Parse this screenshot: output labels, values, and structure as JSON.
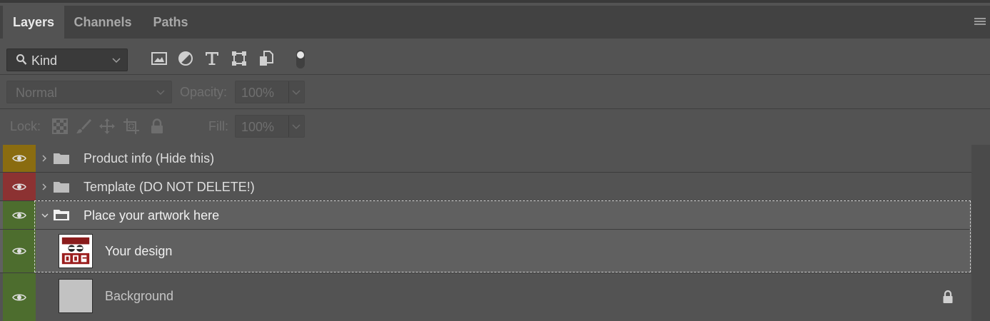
{
  "tabs": [
    {
      "label": "Layers",
      "active": true
    },
    {
      "label": "Channels",
      "active": false
    },
    {
      "label": "Paths",
      "active": false
    }
  ],
  "filter": {
    "kind_label": "Kind",
    "filter_icons": [
      "image-filter-icon",
      "adjustment-filter-icon",
      "type-filter-icon",
      "shape-filter-icon",
      "smart-object-filter-icon",
      "filter-toggle-icon"
    ]
  },
  "blend": {
    "mode": "Normal",
    "opacity_label": "Opacity:",
    "opacity_value": "100%"
  },
  "lock": {
    "label": "Lock:",
    "icons": [
      "lock-transparent-pixels-icon",
      "lock-image-pixels-icon",
      "lock-position-icon",
      "lock-artboard-icon",
      "lock-all-icon"
    ],
    "fill_label": "Fill:",
    "fill_value": "100%"
  },
  "layers": [
    {
      "name": "Product info (Hide this)",
      "type": "group",
      "expanded": false,
      "color": "#8a6c10"
    },
    {
      "name": "Template (DO NOT DELETE!)",
      "type": "group",
      "expanded": false,
      "color": "#8c3232"
    },
    {
      "name": "Place your artwork here",
      "type": "group",
      "expanded": true,
      "color": "#4d6d2e",
      "selected": true
    },
    {
      "name": "Your design",
      "type": "layer",
      "color": "#4d6d2e",
      "selected": true,
      "indent": true
    },
    {
      "name": "Background",
      "type": "background",
      "color": "#4d6d2e",
      "locked": true
    }
  ],
  "colors": {
    "panel_bg": "#535353",
    "selected_row": "#606060",
    "yellow_label": "#8a6c10",
    "red_label": "#8c3232",
    "green_label": "#4d6d2e"
  }
}
